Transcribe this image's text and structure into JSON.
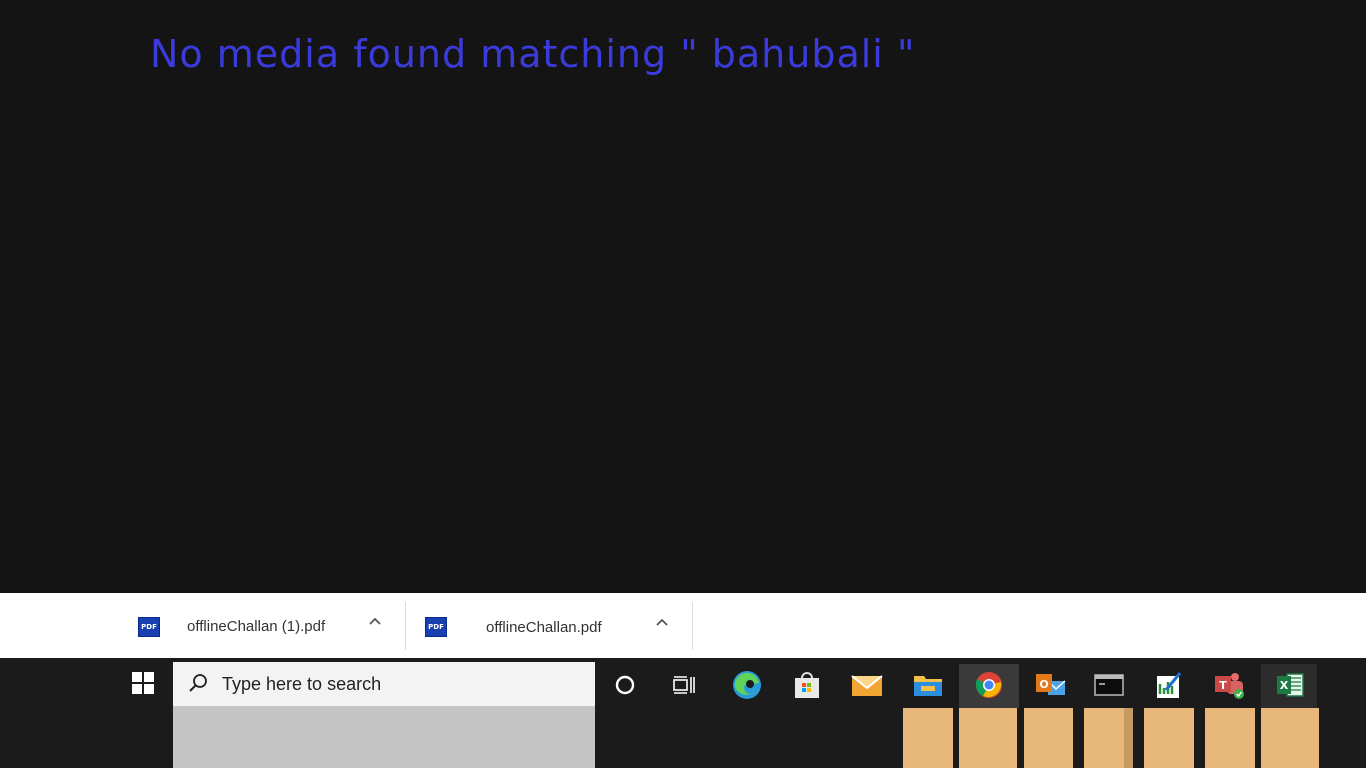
{
  "message": "No media found matching \" bahubali \"",
  "downloads": [
    {
      "icon": "pdf-file-icon",
      "badge": "PDF",
      "name": "offlineChallan (1).pdf"
    },
    {
      "icon": "pdf-file-icon",
      "badge": "PDF",
      "name": "offlineChallan.pdf"
    }
  ],
  "taskbar": {
    "search_placeholder": "Type here to search",
    "apps": [
      "cortana-icon",
      "task-view-icon",
      "edge-icon",
      "store-icon",
      "mail-icon",
      "file-explorer-icon",
      "chrome-icon",
      "outlook-icon",
      "terminal-icon",
      "chart-app-icon",
      "teams-icon",
      "excel-icon"
    ]
  },
  "colors": {
    "message": "#3b3bdd",
    "background": "#141414"
  }
}
